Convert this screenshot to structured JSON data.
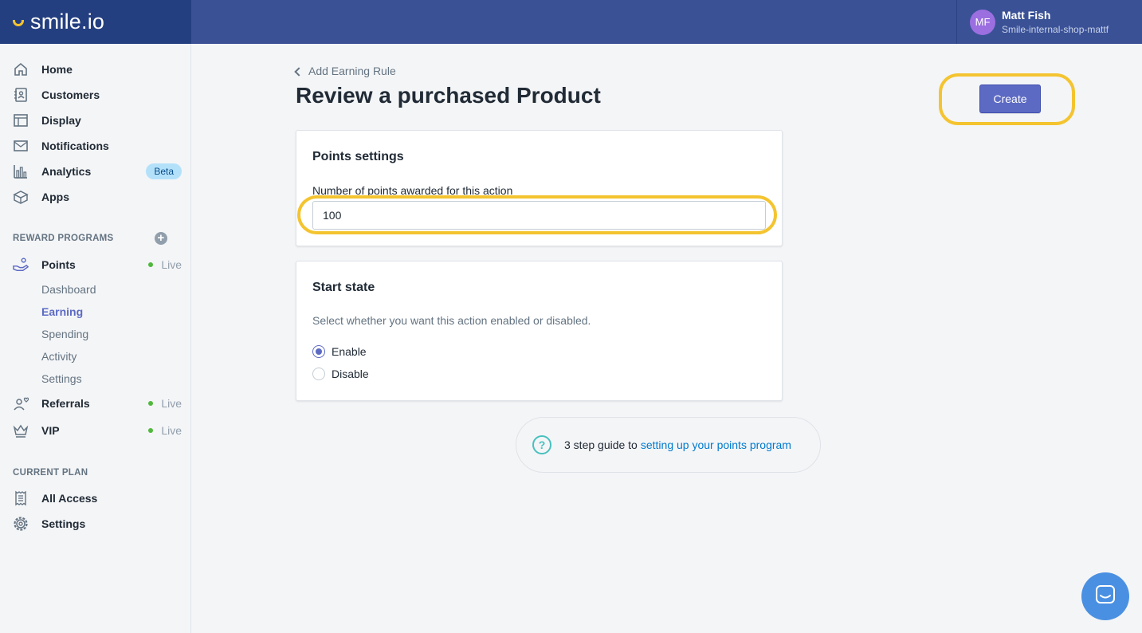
{
  "brand": {
    "name": "smile.io"
  },
  "user": {
    "initials": "MF",
    "name": "Matt Fish",
    "shop": "Smile-internal-shop-mattf"
  },
  "sidebar": {
    "main_items": [
      {
        "label": "Home",
        "icon": "home-icon"
      },
      {
        "label": "Customers",
        "icon": "customers-icon"
      },
      {
        "label": "Display",
        "icon": "display-icon"
      },
      {
        "label": "Notifications",
        "icon": "mail-icon"
      },
      {
        "label": "Analytics",
        "icon": "analytics-icon",
        "badge": "Beta"
      },
      {
        "label": "Apps",
        "icon": "apps-icon"
      }
    ],
    "reward_programs_heading": "REWARD PROGRAMS",
    "points": {
      "label": "Points",
      "status": "Live"
    },
    "points_sub": [
      "Dashboard",
      "Earning",
      "Spending",
      "Activity",
      "Settings"
    ],
    "active_sub": "Earning",
    "referrals": {
      "label": "Referrals",
      "status": "Live"
    },
    "vip": {
      "label": "VIP",
      "status": "Live"
    },
    "current_plan_heading": "CURRENT PLAN",
    "plan_items": [
      {
        "label": "All Access",
        "icon": "receipt-icon"
      },
      {
        "label": "Settings",
        "icon": "gear-icon"
      }
    ]
  },
  "main": {
    "back_label": "Add Earning Rule",
    "title": "Review a purchased Product",
    "create_label": "Create",
    "points_card": {
      "title": "Points settings",
      "field_label": "Number of points awarded for this action",
      "field_value": "100"
    },
    "start_card": {
      "title": "Start state",
      "description": "Select whether you want this action enabled or disabled.",
      "options": [
        "Enable",
        "Disable"
      ],
      "selected": "Enable"
    },
    "guide": {
      "prefix": "3 step guide to",
      "link": "setting up your points program"
    }
  },
  "colors": {
    "accent": "#5c6ac4",
    "topbar": "#3a5196",
    "highlight": "#f4c430",
    "live": "#50b83c"
  }
}
